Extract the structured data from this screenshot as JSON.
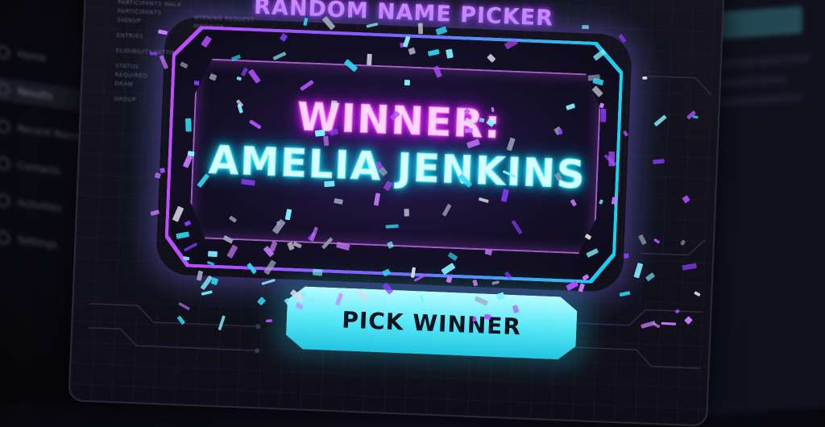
{
  "app": {
    "title": "RANDOM NAME PICKER"
  },
  "result": {
    "label": "WINNER:",
    "name": "AMELIA JENKINS"
  },
  "actions": {
    "pick_label": "PICK WINNER"
  },
  "sidebar": {
    "items": [
      {
        "label": "Home",
        "icon": "home-icon"
      },
      {
        "label": "Results",
        "icon": "list-icon",
        "active": true
      },
      {
        "label": "Recent Names",
        "icon": "history-icon"
      },
      {
        "label": "Contacts",
        "icon": "contacts-icon"
      },
      {
        "label": "Activities",
        "icon": "activity-icon"
      },
      {
        "label": "Settings",
        "icon": "gear-icon"
      }
    ]
  },
  "details_panel": {
    "lines": [
      "PARTICIPANTS WALK",
      "PARTICIPANTS",
      "SIGNUP",
      "ENTRIES",
      "ELIGIBILITY SETTINGS",
      "STATUS",
      "REQUIRED",
      "DRAW",
      "GROUP"
    ],
    "right_lines": [
      "WINNING REQUEST",
      "MODIFIER"
    ]
  },
  "colors": {
    "neon_purple": "#d28bff",
    "neon_cyan": "#18d2f0",
    "button_cyan": "#58e8f8",
    "background": "#0b0b14"
  }
}
